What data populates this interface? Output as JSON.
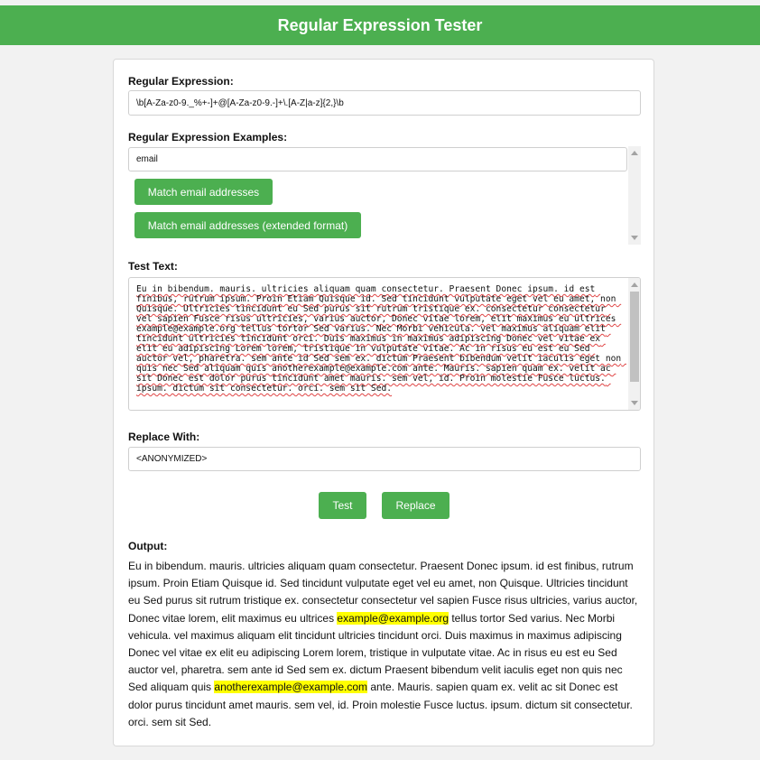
{
  "header": {
    "title": "Regular Expression Tester"
  },
  "regex": {
    "label": "Regular Expression:",
    "value": "\\b[A-Za-z0-9._%+-]+@[A-Za-z0-9.-]+\\.[A-Z|a-z]{2,}\\b"
  },
  "examples": {
    "label": "Regular Expression Examples:",
    "filter_value": "email",
    "buttons": [
      "Match email addresses",
      "Match email addresses (extended format)"
    ]
  },
  "test_text": {
    "label": "Test Text:",
    "value": "Eu in bibendum. mauris. ultricies aliquam quam consectetur. Praesent Donec ipsum. id est finibus, rutrum ipsum. Proin Etiam Quisque id. Sed tincidunt vulputate eget vel eu amet, non Quisque. Ultricies tincidunt eu Sed purus sit rutrum tristique ex. consectetur consectetur vel sapien Fusce risus ultricies, varius auctor, Donec vitae lorem, elit maximus eu ultrices example@example.org tellus tortor Sed varius. Nec Morbi vehicula. vel maximus aliquam elit tincidunt ultricies tincidunt orci. Duis maximus in maximus adipiscing Donec vel vitae ex elit eu adipiscing Lorem lorem, tristique in vulputate vitae. Ac in risus eu est eu Sed auctor vel, pharetra. sem ante id Sed sem ex. dictum Praesent bibendum velit iaculis eget non quis nec Sed aliquam quis anotherexample@example.com ante. Mauris. sapien quam ex. velit ac sit Donec est dolor purus tincidunt amet mauris. sem vel, id. Proin molestie Fusce luctus. ipsum. dictum sit consectetur. orci. sem sit Sed."
  },
  "replace": {
    "label": "Replace With:",
    "value": "<ANONYMIZED>"
  },
  "actions": {
    "test_label": "Test",
    "replace_label": "Replace"
  },
  "output": {
    "label": "Output:",
    "segments": [
      {
        "text": "Eu in bibendum. mauris. ultricies aliquam quam consectetur. Praesent Donec ipsum. id est finibus, rutrum ipsum. Proin Etiam Quisque id. Sed tincidunt vulputate eget vel eu amet, non Quisque. Ultricies tincidunt eu Sed purus sit rutrum tristique ex. consectetur consectetur vel sapien Fusce risus ultricies, varius auctor, Donec vitae lorem, elit maximus eu ultrices ",
        "highlight": false
      },
      {
        "text": "example@example.org",
        "highlight": true
      },
      {
        "text": " tellus tortor Sed varius. Nec Morbi vehicula. vel maximus aliquam elit tincidunt ultricies tincidunt orci. Duis maximus in maximus adipiscing Donec vel vitae ex elit eu adipiscing Lorem lorem, tristique in vulputate vitae. Ac in risus eu est eu Sed auctor vel, pharetra. sem ante id Sed sem ex. dictum Praesent bibendum velit iaculis eget non quis nec Sed aliquam quis ",
        "highlight": false
      },
      {
        "text": "anotherexample@example.com",
        "highlight": true
      },
      {
        "text": " ante. Mauris. sapien quam ex. velit ac sit Donec est dolor purus tincidunt amet mauris. sem vel, id. Proin molestie Fusce luctus. ipsum. dictum sit consectetur. orci. sem sit Sed.",
        "highlight": false
      }
    ]
  },
  "colors": {
    "accent": "#4caf50",
    "highlight": "#ffff00",
    "background": "#f2f2f2"
  },
  "icons": {
    "scroll_up": "chevron-up-icon",
    "scroll_down": "chevron-down-icon"
  }
}
